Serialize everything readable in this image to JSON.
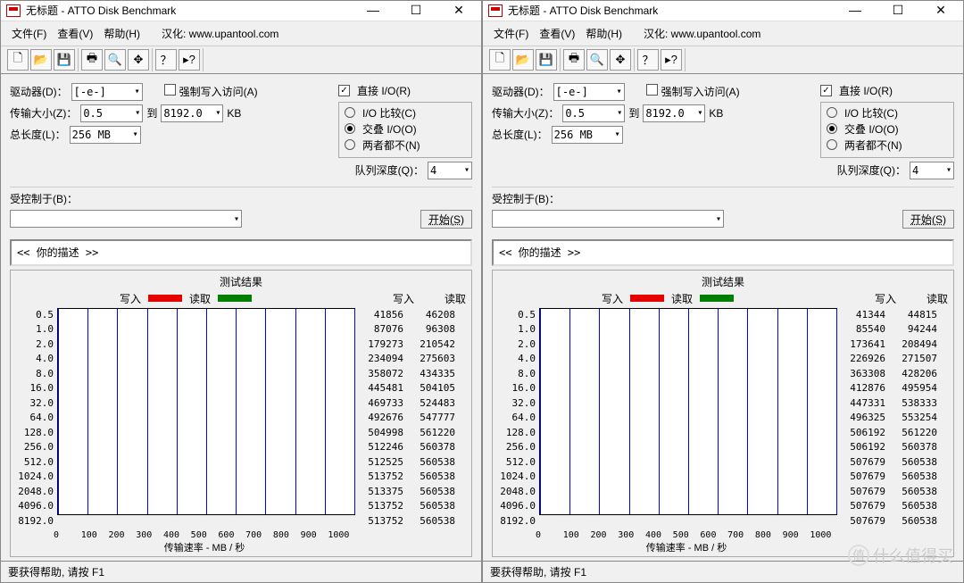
{
  "app": {
    "title": "无标题 - ATTO Disk Benchmark",
    "menus": {
      "file": "文件(F)",
      "view": "查看(V)",
      "help": "帮助(H)",
      "localize": "汉化: www.upantool.com"
    },
    "status": "要获得帮助, 请按 F1"
  },
  "labels": {
    "drive": "驱动器(D)：",
    "xfer": "传输大小(Z)：",
    "to": "到",
    "kb": "KB",
    "totalLen": "总长度(L)：",
    "forceWrite": "强制写入访问(A)",
    "directIO": "直接 I/O(R)",
    "ioCompare": "I/O 比较(C)",
    "overlapIO": "交叠 I/O(O)",
    "neither": "两者都不(N)",
    "queueDepth": "队列深度(Q)：",
    "controlledBy": "受控制于(B)：",
    "start": "开始(S)",
    "desc": "<<  你的描述   >>",
    "resultsTitle": "测试结果",
    "write": "写入",
    "read": "读取",
    "xaxisTitle": "传输速率 - MB / 秒"
  },
  "settings": {
    "drive": "[-e-]",
    "xferMin": "0.5",
    "xferMax": "8192.0",
    "totalLen": "256 MB",
    "queueDepth": "4"
  },
  "xticks": [
    "0",
    "100",
    "200",
    "300",
    "400",
    "500",
    "600",
    "700",
    "800",
    "900",
    "1000"
  ],
  "xmax": 1000,
  "chart_data": [
    {
      "type": "bar",
      "title": "测试结果",
      "xlabel": "传输速率 - MB / 秒",
      "ylabel": "",
      "xlim": [
        0,
        1000
      ],
      "categories": [
        "0.5",
        "1.0",
        "2.0",
        "4.0",
        "8.0",
        "16.0",
        "32.0",
        "64.0",
        "128.0",
        "256.0",
        "512.0",
        "1024.0",
        "2048.0",
        "4096.0",
        "8192.0"
      ],
      "unit": "KB/s",
      "series": [
        {
          "name": "写入",
          "color": "#e60000",
          "values": [
            41856,
            87076,
            179273,
            234094,
            358072,
            445481,
            469733,
            492676,
            504998,
            512246,
            512525,
            513752,
            513375,
            513752,
            513752
          ]
        },
        {
          "name": "读取",
          "color": "#008000",
          "values": [
            46208,
            96308,
            210542,
            275603,
            434335,
            504105,
            524483,
            547777,
            561220,
            560378,
            560538,
            560538,
            560538,
            560538,
            560538
          ]
        }
      ]
    },
    {
      "type": "bar",
      "title": "测试结果",
      "xlabel": "传输速率 - MB / 秒",
      "ylabel": "",
      "xlim": [
        0,
        1000
      ],
      "categories": [
        "0.5",
        "1.0",
        "2.0",
        "4.0",
        "8.0",
        "16.0",
        "32.0",
        "64.0",
        "128.0",
        "256.0",
        "512.0",
        "1024.0",
        "2048.0",
        "4096.0",
        "8192.0"
      ],
      "unit": "KB/s",
      "series": [
        {
          "name": "写入",
          "color": "#e60000",
          "values": [
            41344,
            85540,
            173641,
            226926,
            363308,
            412876,
            447331,
            496325,
            506192,
            506192,
            507679,
            507679,
            507679,
            507679,
            507679
          ]
        },
        {
          "name": "读取",
          "color": "#008000",
          "values": [
            44815,
            94244,
            208494,
            271507,
            428206,
            495954,
            538333,
            553254,
            561220,
            560378,
            560538,
            560538,
            560538,
            560538,
            560538
          ]
        }
      ]
    }
  ],
  "watermark": "什么值得买"
}
